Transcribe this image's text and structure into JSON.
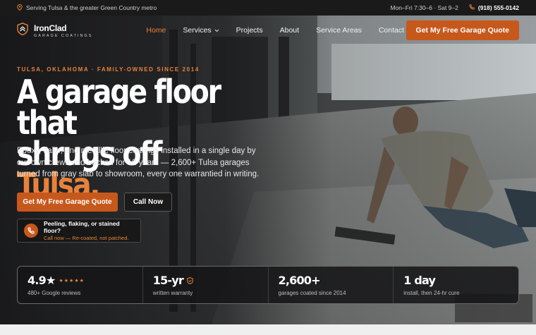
{
  "topbar": {
    "service_area": "Serving Tulsa & the greater Green Country metro",
    "hours": "Mon–Fri 7:30–6 · Sat 9–2",
    "phone": "(918) 555-0142",
    "pin_icon": "map-pin-icon",
    "phone_icon": "phone-icon"
  },
  "nav": {
    "logo_name": "IronClad",
    "logo_sub": "GARAGE COATINGS",
    "items": [
      {
        "label": "Home",
        "active": true
      },
      {
        "label": "Services",
        "dropdown": true
      },
      {
        "label": "Projects"
      },
      {
        "label": "About"
      },
      {
        "label": "Service Areas"
      },
      {
        "label": "Contact"
      }
    ],
    "cta": "Get My Free Garage Quote"
  },
  "hero": {
    "eyebrow": "TULSA, OKLAHOMA · FAMILY-OWNED SINCE 2014",
    "headline_line1": "A garage floor that",
    "headline_line2_prefix": "shrugs off ",
    "headline_accent": "Tulsa.",
    "lede": "Epoxy, flake, and metallic floor coatings installed in a single day by our own crews and backed for 12 years — 2,600+ Tulsa garages turned from gray slab to showroom, every one warrantied in writing.",
    "primary_button": "Get My Free Garage Quote",
    "secondary_button": "Call Now",
    "callout_title": "Peeling, flaking, or stained floor?",
    "callout_sub": "Call now — Re-coated, not patched.",
    "accent_color": "#c7581c"
  },
  "stats": [
    {
      "value": "4.9★",
      "stars": "★★★★★",
      "label": "480+ Google reviews"
    },
    {
      "value": "15-yr",
      "icon": "shield-icon",
      "label": "written warranty"
    },
    {
      "value": "2,600+",
      "label": "garages coated since 2014"
    },
    {
      "value": "1 day",
      "label": "install, then 24-hr cure"
    }
  ]
}
